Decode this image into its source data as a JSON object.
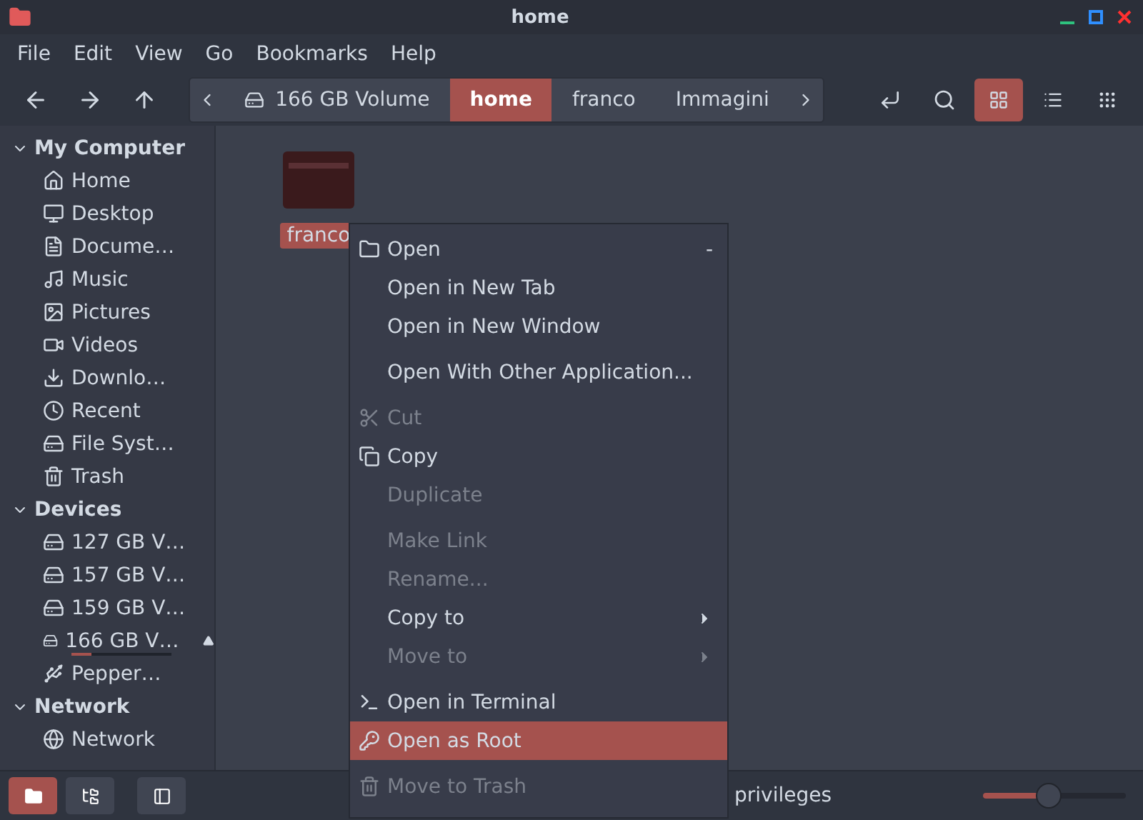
{
  "window": {
    "title": "home"
  },
  "menubar": [
    "File",
    "Edit",
    "View",
    "Go",
    "Bookmarks",
    "Help"
  ],
  "breadcrumb": [
    {
      "label": "166 GB Volume",
      "selected": false
    },
    {
      "label": "home",
      "selected": true
    },
    {
      "label": "franco",
      "selected": false
    },
    {
      "label": "Immagini",
      "selected": false
    }
  ],
  "view_buttons": [
    {
      "selected": true
    },
    {
      "selected": false
    },
    {
      "selected": false
    }
  ],
  "sidebar": [
    {
      "label": "My Computer",
      "expanded": true,
      "children": [
        {
          "label": "Home"
        },
        {
          "label": "Desktop"
        },
        {
          "label": "Docume…"
        },
        {
          "label": "Music"
        },
        {
          "label": "Pictures"
        },
        {
          "label": "Videos"
        },
        {
          "label": "Downlo…"
        },
        {
          "label": "Recent"
        },
        {
          "label": "File Syst…"
        },
        {
          "label": "Trash"
        }
      ]
    },
    {
      "label": "Devices",
      "expanded": true,
      "children": [
        {
          "label": "127 GB V…"
        },
        {
          "label": "157 GB V…"
        },
        {
          "label": "159 GB V…"
        },
        {
          "label": "166 GB V…",
          "level": 0.2,
          "ejectable": true
        },
        {
          "label": "Pepper…"
        }
      ]
    },
    {
      "label": "Network",
      "expanded": true,
      "children": [
        {
          "label": "Network"
        }
      ]
    }
  ],
  "files": [
    {
      "name": "franco",
      "selected": true
    }
  ],
  "context_menu": [
    {
      "kind": "item",
      "label": "Open",
      "disabled": false,
      "selected": false,
      "shortcut": "-"
    },
    {
      "kind": "item",
      "label": "Open in New Tab",
      "disabled": false,
      "selected": false
    },
    {
      "kind": "item",
      "label": "Open in New Window",
      "disabled": false,
      "selected": false
    },
    {
      "kind": "separator"
    },
    {
      "kind": "item",
      "label": "Open With Other Application...",
      "disabled": false,
      "selected": false
    },
    {
      "kind": "separator"
    },
    {
      "kind": "item",
      "label": "Cut",
      "disabled": true,
      "selected": false
    },
    {
      "kind": "item",
      "label": "Copy",
      "disabled": false,
      "selected": false
    },
    {
      "kind": "item",
      "label": "Duplicate",
      "disabled": true,
      "selected": false
    },
    {
      "kind": "separator"
    },
    {
      "kind": "item",
      "label": "Make Link",
      "disabled": true,
      "selected": false
    },
    {
      "kind": "item",
      "label": "Rename...",
      "disabled": true,
      "selected": false
    },
    {
      "kind": "item",
      "label": "Copy to",
      "disabled": false,
      "selected": false,
      "submenu": true
    },
    {
      "kind": "item",
      "label": "Move to",
      "disabled": true,
      "selected": false,
      "submenu": true
    },
    {
      "kind": "separator"
    },
    {
      "kind": "item",
      "label": "Open in Terminal",
      "disabled": false,
      "selected": false
    },
    {
      "kind": "item",
      "label": "Open as Root",
      "disabled": false,
      "selected": true
    },
    {
      "kind": "separator"
    },
    {
      "kind": "item",
      "label": "Move to Trash",
      "disabled": true,
      "selected": false
    }
  ],
  "bottom_buttons": [
    {
      "selected": true
    },
    {
      "selected": false
    },
    {
      "selected": false
    }
  ],
  "status_bar": {
    "text": "privileges",
    "zoom": {
      "level": 0.45
    }
  }
}
